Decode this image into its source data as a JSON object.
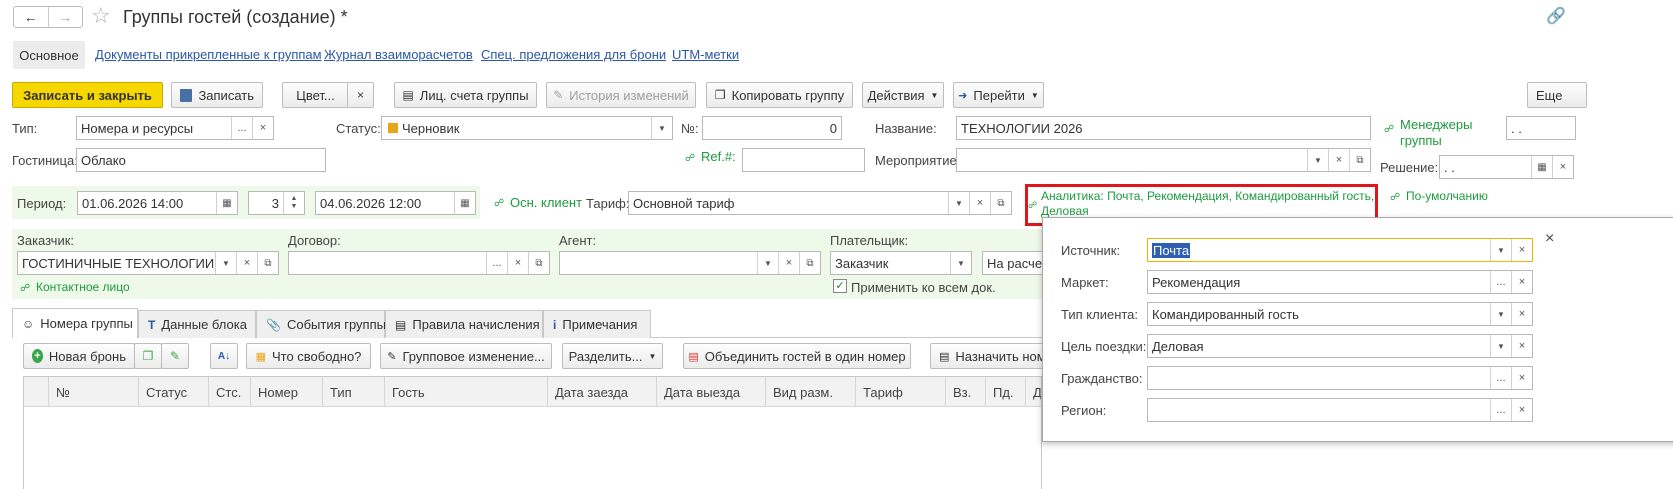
{
  "window": {
    "title": "Группы гостей (создание) *"
  },
  "nav_links": [
    {
      "label": "Основное"
    },
    {
      "label": "Документы прикрепленные к группам"
    },
    {
      "label": "Журнал взаиморасчетов"
    },
    {
      "label": "Спец. предложения для брони"
    },
    {
      "label": "UTM-метки"
    }
  ],
  "toolbar": {
    "save_close": "Записать и закрыть",
    "save": "Записать",
    "color": "Цвет...",
    "accounts": "Лиц. счета группы",
    "history": "История изменений",
    "copy": "Копировать группу",
    "actions": "Действия",
    "goto": "Перейти",
    "more": "Еще"
  },
  "form": {
    "type_label": "Тип:",
    "type_value": "Номера и ресурсы",
    "status_label": "Статус:",
    "status_value": "Черновик",
    "number_label": "№:",
    "number_value": "0",
    "name_label": "Название:",
    "name_value": "ТЕХНОЛОГИИ 2026",
    "managers_link": "Менеджеры группы",
    "managers_value": ". .",
    "hotel_label": "Гостиница:",
    "hotel_value": "Облако",
    "ref_link": "Ref.#:",
    "ref_value": "",
    "event_label": "Мероприятие:",
    "event_value": "",
    "decision_label": "Решение:",
    "decision_value": ". .",
    "period_label": "Период:",
    "period_from": "01.06.2026 14:00",
    "nights": "3",
    "period_to": "04.06.2026 12:00",
    "main_client_link": "Осн. клиент",
    "tariff_label": "Тариф:",
    "tariff_value": "Основной тариф",
    "analytics_line1": "Аналитика: Почта, Рекомендация, Командированный гость,",
    "analytics_line2": "Деловая",
    "default_link": "По-умолчанию",
    "customer_label": "Заказчик:",
    "customer_value": "ГОСТИНИЧНЫЕ ТЕХНОЛОГИИ",
    "contract_label": "Договор:",
    "contract_value": "",
    "agent_label": "Агент:",
    "agent_value": "",
    "payer_label": "Плательщик:",
    "payer_value": "Заказчик",
    "payer_calc_value": "На расчет",
    "contact_link": "Контактное лицо",
    "apply_all_label": "Применить ко всем док."
  },
  "tabs": [
    {
      "label": "Номера группы"
    },
    {
      "label": "Данные блока"
    },
    {
      "label": "События группы"
    },
    {
      "label": "Правила начисления"
    },
    {
      "label": "Примечания"
    }
  ],
  "table_toolbar": {
    "new_booking": "Новая бронь",
    "what_free": "Что свободно?",
    "group_change": "Групповое изменение...",
    "split": "Разделить...",
    "merge": "Объединить гостей в один номер",
    "assign": "Назначить ном"
  },
  "table_columns": [
    "№",
    "Статус",
    "Стс.",
    "Номер",
    "Тип",
    "Гость",
    "Дата заезда",
    "Дата выезда",
    "Вид разм.",
    "Тариф",
    "Вз.",
    "Пд.",
    "Дт."
  ],
  "popup": {
    "rows": [
      {
        "label": "Источник:",
        "value": "Почта"
      },
      {
        "label": "Маркет:",
        "value": "Рекомендация"
      },
      {
        "label": "Тип клиента:",
        "value": "Командированный гость"
      },
      {
        "label": "Цель поездки:",
        "value": "Деловая"
      },
      {
        "label": "Гражданство:",
        "value": ""
      },
      {
        "label": "Регион:",
        "value": ""
      }
    ]
  },
  "colors": {
    "accent_yellow": "#f6d700",
    "link_green": "#1d9b3d",
    "link_blue": "#2a58a6",
    "highlight_red": "#e0161b",
    "status_orange": "#e8a317"
  }
}
